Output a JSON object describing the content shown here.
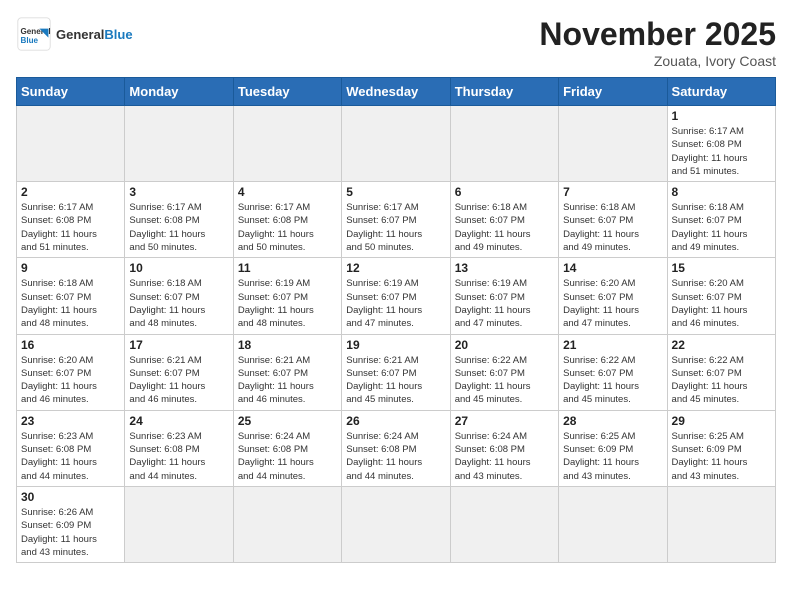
{
  "header": {
    "logo_general": "General",
    "logo_blue": "Blue",
    "month_title": "November 2025",
    "location": "Zouata, Ivory Coast"
  },
  "days_of_week": [
    "Sunday",
    "Monday",
    "Tuesday",
    "Wednesday",
    "Thursday",
    "Friday",
    "Saturday"
  ],
  "weeks": [
    [
      {
        "day": "",
        "info": ""
      },
      {
        "day": "",
        "info": ""
      },
      {
        "day": "",
        "info": ""
      },
      {
        "day": "",
        "info": ""
      },
      {
        "day": "",
        "info": ""
      },
      {
        "day": "",
        "info": ""
      },
      {
        "day": "1",
        "info": "Sunrise: 6:17 AM\nSunset: 6:08 PM\nDaylight: 11 hours\nand 51 minutes."
      }
    ],
    [
      {
        "day": "2",
        "info": "Sunrise: 6:17 AM\nSunset: 6:08 PM\nDaylight: 11 hours\nand 51 minutes."
      },
      {
        "day": "3",
        "info": "Sunrise: 6:17 AM\nSunset: 6:08 PM\nDaylight: 11 hours\nand 50 minutes."
      },
      {
        "day": "4",
        "info": "Sunrise: 6:17 AM\nSunset: 6:08 PM\nDaylight: 11 hours\nand 50 minutes."
      },
      {
        "day": "5",
        "info": "Sunrise: 6:17 AM\nSunset: 6:07 PM\nDaylight: 11 hours\nand 50 minutes."
      },
      {
        "day": "6",
        "info": "Sunrise: 6:18 AM\nSunset: 6:07 PM\nDaylight: 11 hours\nand 49 minutes."
      },
      {
        "day": "7",
        "info": "Sunrise: 6:18 AM\nSunset: 6:07 PM\nDaylight: 11 hours\nand 49 minutes."
      },
      {
        "day": "8",
        "info": "Sunrise: 6:18 AM\nSunset: 6:07 PM\nDaylight: 11 hours\nand 49 minutes."
      }
    ],
    [
      {
        "day": "9",
        "info": "Sunrise: 6:18 AM\nSunset: 6:07 PM\nDaylight: 11 hours\nand 48 minutes."
      },
      {
        "day": "10",
        "info": "Sunrise: 6:18 AM\nSunset: 6:07 PM\nDaylight: 11 hours\nand 48 minutes."
      },
      {
        "day": "11",
        "info": "Sunrise: 6:19 AM\nSunset: 6:07 PM\nDaylight: 11 hours\nand 48 minutes."
      },
      {
        "day": "12",
        "info": "Sunrise: 6:19 AM\nSunset: 6:07 PM\nDaylight: 11 hours\nand 47 minutes."
      },
      {
        "day": "13",
        "info": "Sunrise: 6:19 AM\nSunset: 6:07 PM\nDaylight: 11 hours\nand 47 minutes."
      },
      {
        "day": "14",
        "info": "Sunrise: 6:20 AM\nSunset: 6:07 PM\nDaylight: 11 hours\nand 47 minutes."
      },
      {
        "day": "15",
        "info": "Sunrise: 6:20 AM\nSunset: 6:07 PM\nDaylight: 11 hours\nand 46 minutes."
      }
    ],
    [
      {
        "day": "16",
        "info": "Sunrise: 6:20 AM\nSunset: 6:07 PM\nDaylight: 11 hours\nand 46 minutes."
      },
      {
        "day": "17",
        "info": "Sunrise: 6:21 AM\nSunset: 6:07 PM\nDaylight: 11 hours\nand 46 minutes."
      },
      {
        "day": "18",
        "info": "Sunrise: 6:21 AM\nSunset: 6:07 PM\nDaylight: 11 hours\nand 46 minutes."
      },
      {
        "day": "19",
        "info": "Sunrise: 6:21 AM\nSunset: 6:07 PM\nDaylight: 11 hours\nand 45 minutes."
      },
      {
        "day": "20",
        "info": "Sunrise: 6:22 AM\nSunset: 6:07 PM\nDaylight: 11 hours\nand 45 minutes."
      },
      {
        "day": "21",
        "info": "Sunrise: 6:22 AM\nSunset: 6:07 PM\nDaylight: 11 hours\nand 45 minutes."
      },
      {
        "day": "22",
        "info": "Sunrise: 6:22 AM\nSunset: 6:07 PM\nDaylight: 11 hours\nand 45 minutes."
      }
    ],
    [
      {
        "day": "23",
        "info": "Sunrise: 6:23 AM\nSunset: 6:08 PM\nDaylight: 11 hours\nand 44 minutes."
      },
      {
        "day": "24",
        "info": "Sunrise: 6:23 AM\nSunset: 6:08 PM\nDaylight: 11 hours\nand 44 minutes."
      },
      {
        "day": "25",
        "info": "Sunrise: 6:24 AM\nSunset: 6:08 PM\nDaylight: 11 hours\nand 44 minutes."
      },
      {
        "day": "26",
        "info": "Sunrise: 6:24 AM\nSunset: 6:08 PM\nDaylight: 11 hours\nand 44 minutes."
      },
      {
        "day": "27",
        "info": "Sunrise: 6:24 AM\nSunset: 6:08 PM\nDaylight: 11 hours\nand 43 minutes."
      },
      {
        "day": "28",
        "info": "Sunrise: 6:25 AM\nSunset: 6:09 PM\nDaylight: 11 hours\nand 43 minutes."
      },
      {
        "day": "29",
        "info": "Sunrise: 6:25 AM\nSunset: 6:09 PM\nDaylight: 11 hours\nand 43 minutes."
      }
    ],
    [
      {
        "day": "30",
        "info": "Sunrise: 6:26 AM\nSunset: 6:09 PM\nDaylight: 11 hours\nand 43 minutes."
      },
      {
        "day": "",
        "info": ""
      },
      {
        "day": "",
        "info": ""
      },
      {
        "day": "",
        "info": ""
      },
      {
        "day": "",
        "info": ""
      },
      {
        "day": "",
        "info": ""
      },
      {
        "day": "",
        "info": ""
      }
    ]
  ]
}
